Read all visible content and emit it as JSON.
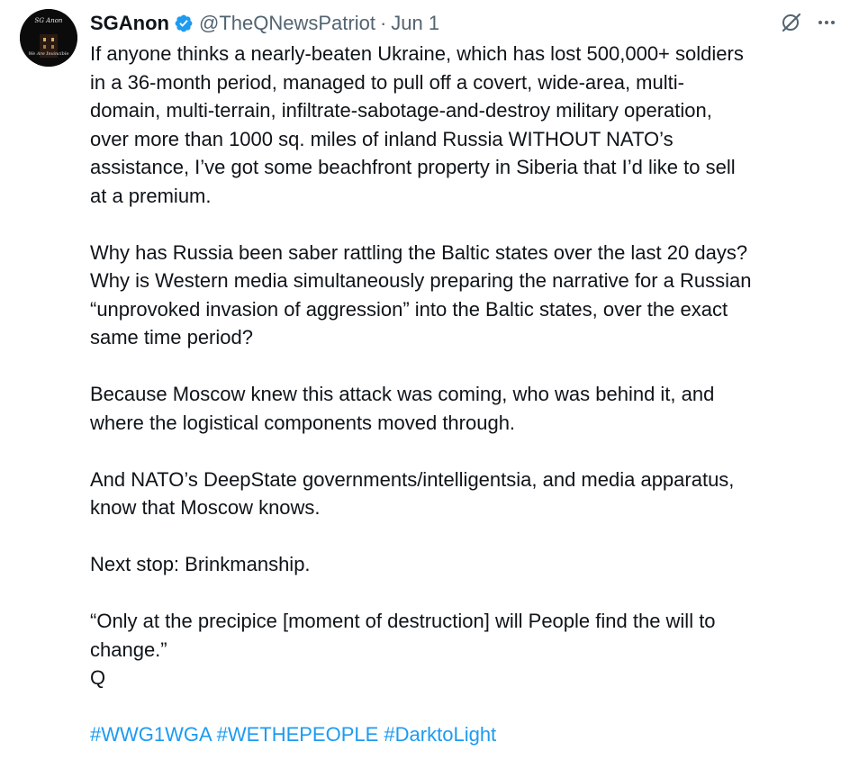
{
  "author": {
    "display_name": "SGAnon",
    "handle": "@TheQNewsPatriot",
    "separator": "·",
    "date": "Jun 1",
    "avatar_text_top": "SG Anon",
    "avatar_text_bottom": "We Are Invincible"
  },
  "icons": {
    "verified": "verified-badge-icon",
    "grok": "grok-icon",
    "more": "more-icon",
    "accent": "#1d9bf0"
  },
  "tweet": {
    "p1": [
      "If anyone thinks a nearly-beaten Ukraine, which has lost 500,000+ soldiers",
      "in a 36-month period, managed to pull off a covert, wide-area, multi-",
      "domain, multi-terrain, infiltrate-sabotage-and-destroy military operation,",
      "over more than 1000 sq. miles of inland Russia WITHOUT NATO’s",
      "assistance, I’ve got some beachfront property in Siberia that I’d like to sell",
      "at a premium."
    ],
    "p2": [
      "Why has Russia been saber rattling the Baltic states over the last 20 days?",
      "Why is Western media simultaneously preparing the narrative for a Russian",
      "“unprovoked invasion of aggression” into the Baltic states, over the exact",
      "same time period?"
    ],
    "p3": [
      "Because Moscow knew this attack was coming, who was behind it, and",
      "where the logistical components moved through."
    ],
    "p4": [
      "And NATO’s DeepState governments/intelligentsia, and media apparatus,",
      "know that Moscow knows."
    ],
    "p5": [
      "Next stop: Brinkmanship."
    ],
    "p6": [
      "“Only at the precipice [moment of destruction] will People find the will to",
      "change.”",
      "Q"
    ],
    "hashtags": [
      "#WWG1WGA",
      "#WETHEPEOPLE",
      "#DarktoLight"
    ]
  }
}
